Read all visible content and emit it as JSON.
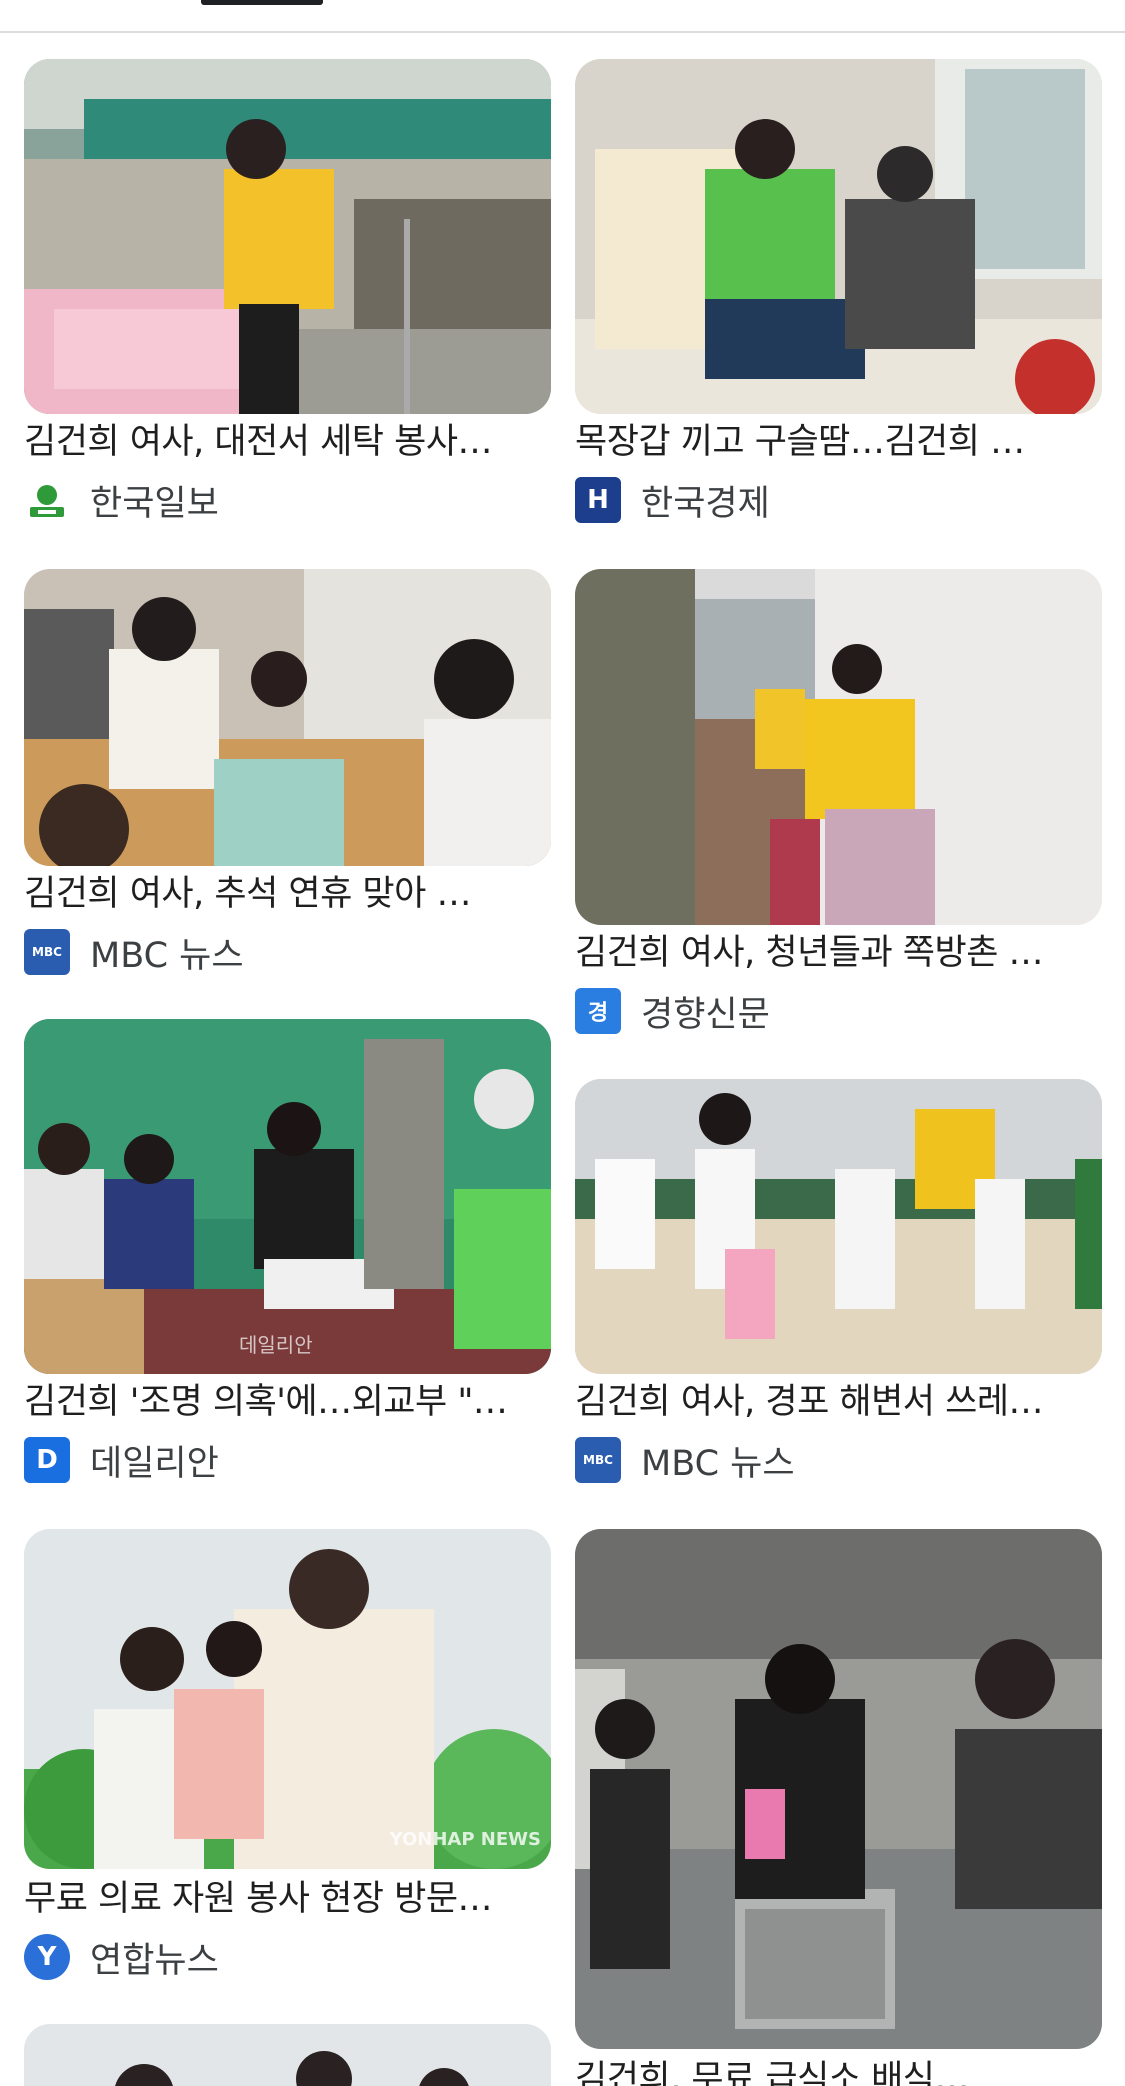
{
  "cards": [
    {
      "title": "김건희 여사, 대전서 세탁 봉사…",
      "source": "한국일보",
      "icon": "hankook-ilbo-icon"
    },
    {
      "title": "목장갑 끼고 구슬땀…김건희 …",
      "source": "한국경제",
      "icon": "hankyung-icon"
    },
    {
      "title": "김건희 여사, 추석 연휴 맞아 …",
      "source": "MBC 뉴스",
      "icon": "mbc-news-icon"
    },
    {
      "title": "김건희 여사, 청년들과 쪽방촌 …",
      "source": "경향신문",
      "icon": "kyunghyang-icon"
    },
    {
      "title": "김건희 '조명 의혹'에…외교부 \"…",
      "source": "데일리안",
      "icon": "dailian-icon"
    },
    {
      "title": "김건희 여사, 경포 해변서 쓰레…",
      "source": "MBC 뉴스",
      "icon": "mbc-news-icon"
    },
    {
      "title": "무료 의료 자원 봉사 현장 방문…",
      "source": "연합뉴스",
      "icon": "yonhap-icon"
    },
    {
      "title": "김건희, 무료 급식소 배식…",
      "source": "",
      "icon": ""
    }
  ],
  "watermarks": {
    "dailian": "데일리안",
    "yonhap": "YONHAP NEWS"
  },
  "icon_text": {
    "hankyung": "H",
    "dailian": "D",
    "kyunghyang": "경",
    "mbc": "MBC",
    "yonhap": "Y"
  },
  "colors": {
    "hankook": "#2f9a3a",
    "hankyung": "#1c3e8c",
    "mbc": "#2a5db0",
    "kyunghyang": "#2a7de1",
    "dailian": "#1a6fe0",
    "yonhap": "#2b6fd9"
  }
}
